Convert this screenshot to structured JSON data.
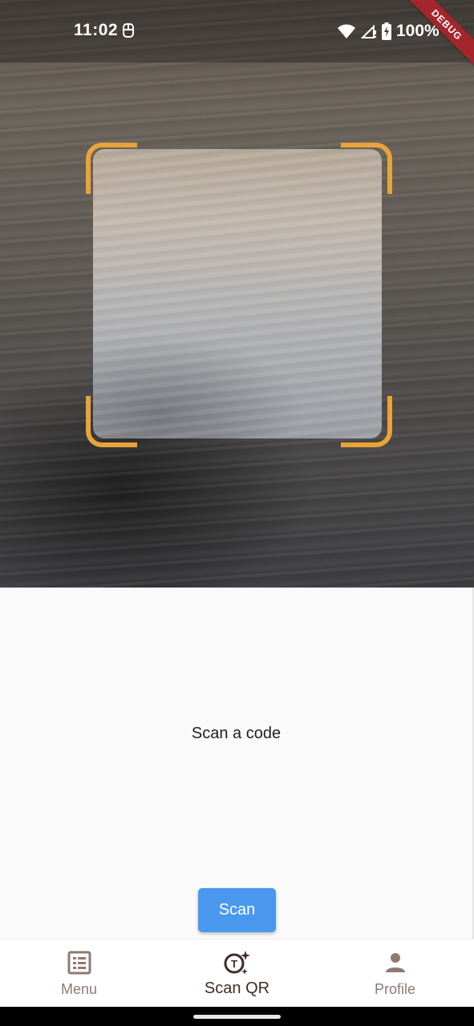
{
  "status_bar": {
    "time": "11:02",
    "battery": "100%",
    "icons": [
      "data-saver-icon",
      "wifi-icon",
      "signal-icon",
      "battery-charging-icon"
    ]
  },
  "debug_banner": "DEBUG",
  "scanner": {
    "frame_color": "#e8a33a"
  },
  "result": {
    "text": "Scan a code"
  },
  "scan_button": {
    "label": "Scan",
    "color": "#4a98ee"
  },
  "bottom_nav": {
    "items": [
      {
        "label": "Menu",
        "icon": "menu-list-icon",
        "active": false
      },
      {
        "label": "Scan QR",
        "icon": "scan-qr-icon",
        "active": true
      },
      {
        "label": "Profile",
        "icon": "person-icon",
        "active": false
      }
    ]
  }
}
